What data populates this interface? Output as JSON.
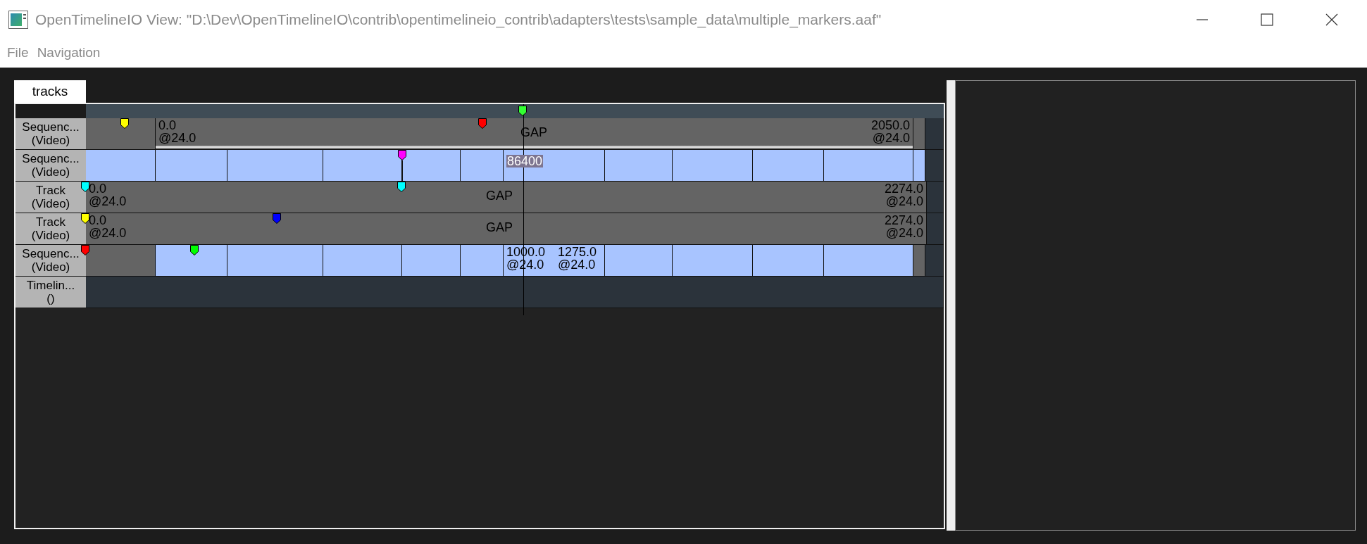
{
  "window": {
    "title": "OpenTimelineIO View: \"D:\\Dev\\OpenTimelineIO\\contrib\\opentimelineio_contrib\\adapters\\tests\\sample_data\\multiple_markers.aaf\""
  },
  "menu": [
    "File",
    "Navigation"
  ],
  "tabs": [
    {
      "label": "tracks",
      "selected": true
    }
  ],
  "ruler": {
    "markers": [
      {
        "color": "#33ff33"
      }
    ]
  },
  "tracks": [
    {
      "name": "Sequenc...",
      "type": "(Video)",
      "markers": [
        {
          "color": "#ffff00"
        },
        {
          "color": "#ff0000"
        }
      ],
      "clips": [
        {
          "kind": "filler"
        },
        {
          "kind": "gap",
          "start": "0.0",
          "start_rate": "@24.0",
          "title": "GAP",
          "end": "2050.0",
          "end_rate": "@24.0",
          "bar": true
        },
        {
          "kind": "filler"
        }
      ]
    },
    {
      "name": "Sequenc...",
      "type": "(Video)",
      "markers": [
        {
          "color": "#ff00ff"
        }
      ],
      "clips": [
        {
          "kind": "clip"
        },
        {
          "kind": "clip"
        },
        {
          "kind": "clip"
        },
        {
          "kind": "clip"
        },
        {
          "kind": "clip"
        },
        {
          "kind": "clip"
        },
        {
          "kind": "clip",
          "title": "86400",
          "highlighted": true
        },
        {
          "kind": "clip"
        },
        {
          "kind": "clip"
        },
        {
          "kind": "clip"
        },
        {
          "kind": "clip"
        },
        {
          "kind": "clip"
        }
      ]
    },
    {
      "name": "Track",
      "type": "(Video)",
      "markers": [
        {
          "color": "#00ffff"
        },
        {
          "color": "#00ffff"
        }
      ],
      "clips": [
        {
          "kind": "gap",
          "start": "0.0",
          "start_rate": "@24.0",
          "title": "GAP",
          "end": "2274.0",
          "end_rate": "@24.0"
        }
      ]
    },
    {
      "name": "Track",
      "type": "(Video)",
      "markers": [
        {
          "color": "#ffff00"
        },
        {
          "color": "#0000ff"
        }
      ],
      "clips": [
        {
          "kind": "gap",
          "start": "0.0",
          "start_rate": "@24.0",
          "title": "GAP",
          "end": "2274.0",
          "end_rate": "@24.0"
        }
      ]
    },
    {
      "name": "Sequenc...",
      "type": "(Video)",
      "markers": [
        {
          "color": "#ff0000"
        },
        {
          "color": "#00ff00"
        }
      ],
      "clips": [
        {
          "kind": "filler"
        },
        {
          "kind": "clip"
        },
        {
          "kind": "clip"
        },
        {
          "kind": "clip"
        },
        {
          "kind": "clip"
        },
        {
          "kind": "clip"
        },
        {
          "kind": "clip",
          "start": "1000.0",
          "start_rate": "@24.0",
          "end": "1275.0",
          "end_rate": "@24.0"
        },
        {
          "kind": "clip"
        },
        {
          "kind": "clip"
        },
        {
          "kind": "clip"
        },
        {
          "kind": "clip"
        },
        {
          "kind": "filler"
        }
      ]
    },
    {
      "name": "Timelin...",
      "type": "()"
    }
  ]
}
